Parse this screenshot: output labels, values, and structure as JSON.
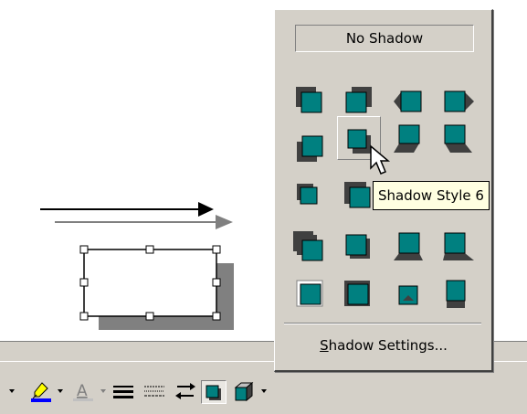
{
  "palette": {
    "no_shadow_label": "No Shadow",
    "settings_label_first": "S",
    "settings_label_rest": "hadow Settings...",
    "hovered_style": "Shadow Style 6"
  },
  "tooltip": {
    "text": "Shadow Style 6"
  },
  "icons": {
    "line-color": "pen-icon",
    "font-color": "letter-a-icon",
    "line-style": "line-style-icon",
    "dash-style": "dash-style-icon",
    "arrow-style": "arrow-style-icon",
    "shadow": "shadow-icon",
    "3d": "3d-icon"
  },
  "colors": {
    "teal": "#008080",
    "shadow": "#808080",
    "highlight_blue": "#0000ff"
  }
}
